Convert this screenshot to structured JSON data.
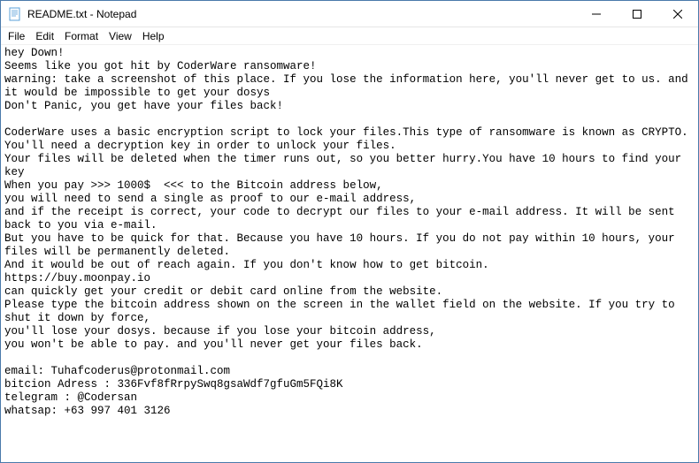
{
  "window": {
    "title": "README.txt - Notepad",
    "icon_name": "notepad-icon"
  },
  "menubar": {
    "items": [
      "File",
      "Edit",
      "Format",
      "View",
      "Help"
    ]
  },
  "content": {
    "text": "hey Down!\nSeems like you got hit by CoderWare ransomware!\nwarning: take a screenshot of this place. If you lose the information here, you'll never get to us. and it would be impossible to get your dosys\nDon't Panic, you get have your files back!\n\nCoderWare uses a basic encryption script to lock your files.This type of ransomware is known as CRYPTO. You'll need a decryption key in order to unlock your files.\nYour files will be deleted when the timer runs out, so you better hurry.You have 10 hours to find your key\nWhen you pay >>> 1000$  <<< to the Bitcoin address below,\nyou will need to send a single as proof to our e-mail address,\nand if the receipt is correct, your code to decrypt our files to your e-mail address. It will be sent back to you via e-mail.\nBut you have to be quick for that. Because you have 10 hours. If you do not pay within 10 hours, your files will be permanently deleted.\nAnd it would be out of reach again. If you don't know how to get bitcoin.\nhttps://buy.moonpay.io\ncan quickly get your credit or debit card online from the website.\nPlease type the bitcoin address shown on the screen in the wallet field on the website. If you try to shut it down by force,\nyou'll lose your dosys. because if you lose your bitcoin address,\nyou won't be able to pay. and you'll never get your files back.\n\nemail: Tuhafcoderus@protonmail.com\nbitcion Adress : 336Fvf8fRrpySwq8gsaWdf7gfuGm5FQi8K\ntelegram : @Codersan\nwhatsap: +63 997 401 3126"
  }
}
